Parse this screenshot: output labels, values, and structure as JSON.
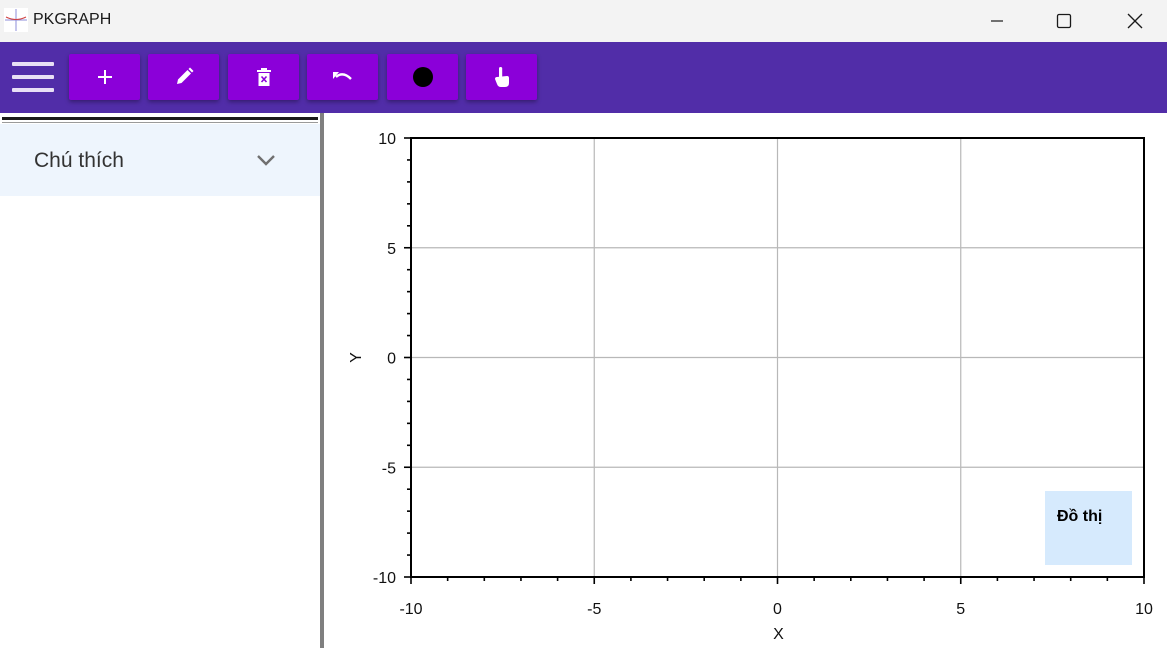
{
  "window": {
    "title": "PKGRAPH",
    "controls": [
      "minimize-icon",
      "maximize-icon",
      "close-icon"
    ]
  },
  "toolbar": {
    "menu_icon": "hamburger-menu-icon",
    "buttons": [
      {
        "name": "add-button",
        "icon": "plus-icon"
      },
      {
        "name": "edit-button",
        "icon": "pencil-icon"
      },
      {
        "name": "delete-button",
        "icon": "trash-icon"
      },
      {
        "name": "undo-button",
        "icon": "undo-icon"
      },
      {
        "name": "color-button",
        "icon": "circle-icon"
      },
      {
        "name": "pointer-button",
        "icon": "hand-pointer-icon"
      }
    ],
    "accent": "#512da8",
    "button_color": "#8b00d9"
  },
  "sidebar": {
    "expander_label": "Chú thích",
    "expander_icon": "chevron-down-icon"
  },
  "chart_data": {
    "type": "line",
    "xlabel": "X",
    "ylabel": "Y",
    "xlim": [
      -10,
      10
    ],
    "ylim": [
      -10,
      10
    ],
    "x_ticks": [
      "-10",
      "-5",
      "0",
      "5",
      "10"
    ],
    "y_ticks": [
      "10",
      "5",
      "0",
      "-5",
      "-10"
    ],
    "grid": true,
    "legend_title": "Đồ thị",
    "legend_position": "bottom-right",
    "series": []
  }
}
